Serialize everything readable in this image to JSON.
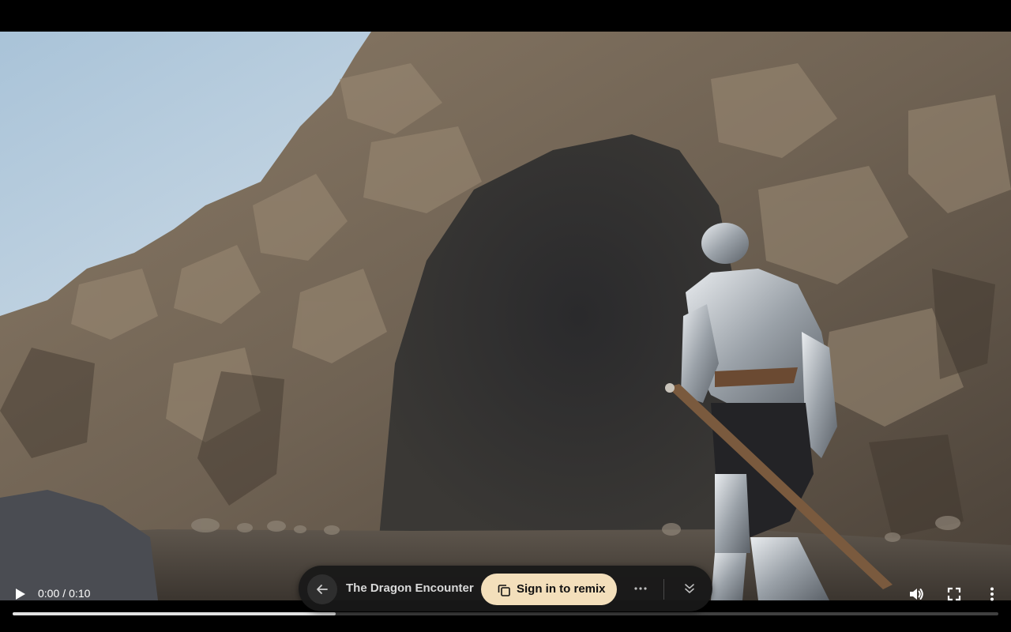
{
  "player": {
    "current_time": "0:00",
    "separator": "/",
    "duration": "0:10",
    "progress_fraction": 0,
    "buffered_fraction": 0.328,
    "icons": {
      "play": "play-icon",
      "volume": "volume-icon",
      "fullscreen": "fullscreen-icon",
      "menu": "more-vertical-icon"
    }
  },
  "remix_bar": {
    "back_icon": "arrow-left-icon",
    "title": "The Dragon Encounter",
    "remix_label": "Sign in to remix",
    "remix_icon": "copy-icon",
    "more_icon": "more-horizontal-icon",
    "collapse_icon": "chevrons-down-icon"
  },
  "colors": {
    "background": "#000000",
    "remix_button": "#f3dfbb",
    "bar_background": "#181818",
    "text_primary": "#ffffff",
    "text_muted": "#d9d9d9"
  }
}
